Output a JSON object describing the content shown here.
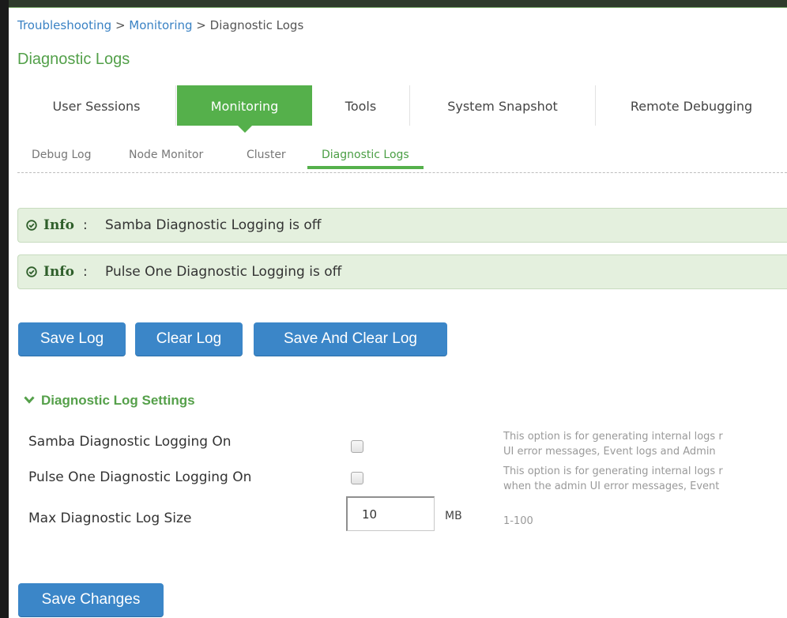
{
  "breadcrumb": {
    "items": [
      "Troubleshooting",
      "Monitoring",
      "Diagnostic Logs"
    ],
    "separator": ">"
  },
  "page": {
    "title": "Diagnostic Logs"
  },
  "main_tabs": [
    {
      "label": "User Sessions",
      "active": false
    },
    {
      "label": "Monitoring",
      "active": true
    },
    {
      "label": "Tools",
      "active": false
    },
    {
      "label": "System Snapshot",
      "active": false
    },
    {
      "label": "Remote Debugging",
      "active": false
    }
  ],
  "sub_tabs": [
    {
      "label": "Debug Log",
      "active": false
    },
    {
      "label": "Node Monitor",
      "active": false
    },
    {
      "label": "Cluster",
      "active": false
    },
    {
      "label": "Diagnostic Logs",
      "active": true
    }
  ],
  "info_messages": [
    {
      "label": "Info",
      "separator": ":",
      "text": "Samba Diagnostic Logging is off",
      "icon": "check-circle-icon"
    },
    {
      "label": "Info",
      "separator": ":",
      "text": "Pulse One Diagnostic Logging is off",
      "icon": "check-circle-icon"
    }
  ],
  "actions": {
    "save_log": "Save Log",
    "clear_log": "Clear Log",
    "save_and_clear_log": "Save And Clear Log"
  },
  "settings": {
    "section_title": "Diagnostic Log Settings",
    "samba": {
      "label": "Samba Diagnostic Logging On",
      "checked": false,
      "help_line1": "This option is for generating internal logs r",
      "help_line2": "UI error messages, Event logs and Admin"
    },
    "pulse_one": {
      "label": "Pulse One Diagnostic Logging On",
      "checked": false,
      "help_line1": "This option is for generating internal logs r",
      "help_line2": "when the admin UI error messages, Event"
    },
    "max_size": {
      "label": "Max Diagnostic Log Size",
      "value": "10",
      "unit": "MB",
      "help": "1-100"
    }
  },
  "save_changes": "Save Changes",
  "colors": {
    "accent_green": "#55b04b",
    "link_blue": "#3a82c4",
    "button_blue": "#3b86c8",
    "info_bg": "#e4f0de"
  }
}
